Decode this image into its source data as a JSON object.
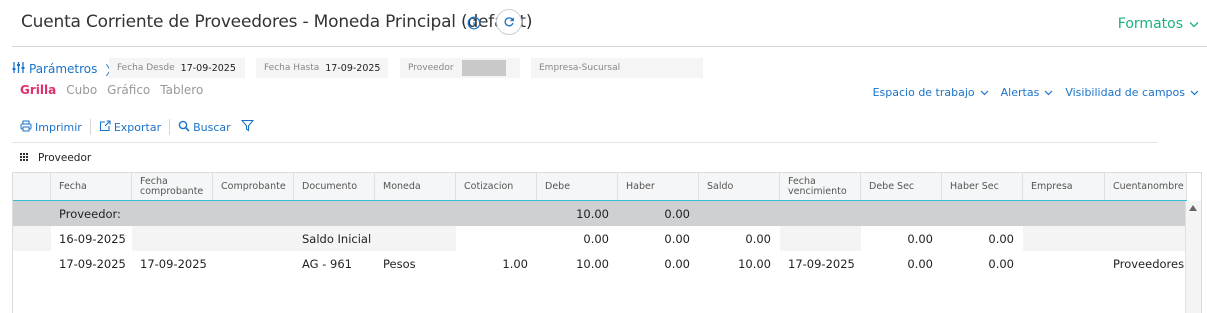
{
  "header": {
    "title": "Cuenta Corriente de Proveedores - Moneda Principal (default)",
    "formatos_label": "Formatos"
  },
  "params": {
    "label": "Parámetros",
    "fields": [
      {
        "label": "Fecha Desde",
        "value": "17-09-2025"
      },
      {
        "label": "Fecha Hasta",
        "value": "17-09-2025"
      },
      {
        "label": "Proveedor",
        "value": ""
      },
      {
        "label": "Empresa-Sucursal",
        "value": ""
      }
    ]
  },
  "views": [
    "Grilla",
    "Cubo",
    "Gráfico",
    "Tablero"
  ],
  "active_view": "Grilla",
  "right_links": [
    "Espacio de trabajo",
    "Alertas",
    "Visibilidad de campos"
  ],
  "toolbar": {
    "print": "Imprimir",
    "export": "Exportar",
    "search": "Buscar"
  },
  "group_by": "Proveedor",
  "grid": {
    "columns": [
      "Fecha",
      "Fecha comprobante",
      "Comprobante",
      "Documento",
      "Moneda",
      "Cotizacion",
      "Debe",
      "Haber",
      "Saldo",
      "Fecha vencimiento",
      "Debe Sec",
      "Haber Sec",
      "Empresa",
      "Cuentanombre"
    ],
    "group_row": {
      "label": "Proveedor: ",
      "debe": "10.00",
      "haber": "0.00"
    },
    "rows": [
      [
        "16-09-2025",
        "",
        "",
        "Saldo Inicial",
        "",
        "",
        "0.00",
        "0.00",
        "0.00",
        "",
        "0.00",
        "0.00",
        "",
        ""
      ],
      [
        "17-09-2025",
        "17-09-2025",
        "",
        "AG - 961",
        "Pesos",
        "1.00",
        "10.00",
        "0.00",
        "10.00",
        "17-09-2025",
        "0.00",
        "0.00",
        "",
        "Proveedores"
      ]
    ]
  },
  "colors": {
    "accent": "#1a73c8",
    "formatos": "#19b37a",
    "active_tab": "#e0306b",
    "header_border": "#37bcd2"
  }
}
